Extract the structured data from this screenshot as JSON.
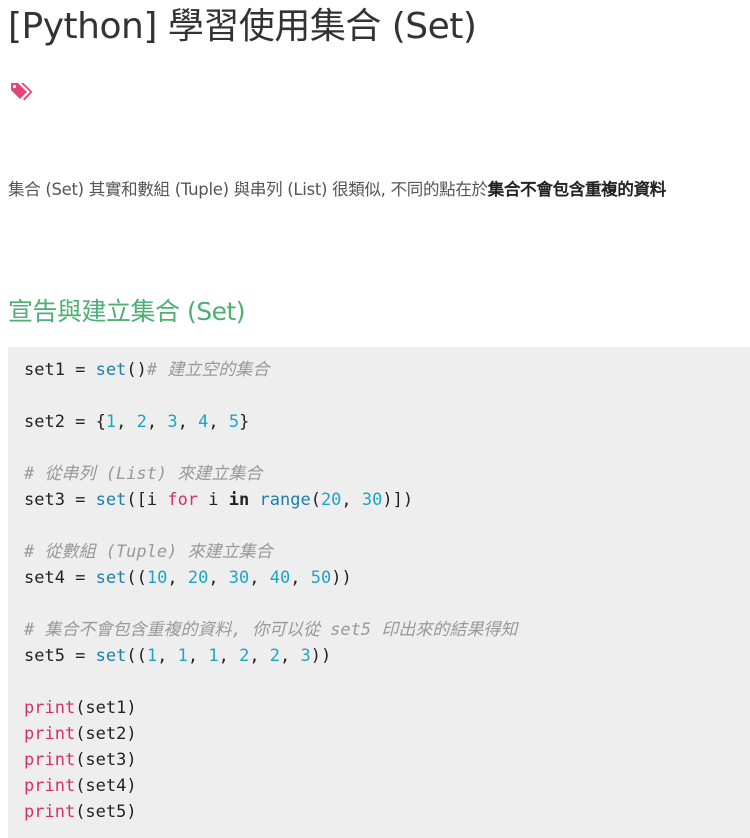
{
  "page": {
    "title": "[Python] 學習使用集合 (Set)",
    "tags_icon": "tags-icon"
  },
  "intro": {
    "text": "集合 (Set) 其實和數組 (Tuple) 與串列 (List) 很類似, 不同的點在於",
    "bold": "集合不會包含重複的資料"
  },
  "section": {
    "heading": "宣告與建立集合 (Set)"
  },
  "colors": {
    "heading_green": "#4caf74",
    "tag_pink": "#e0467a",
    "code_background": "#eeeeee",
    "number_blue": "#1aa5c9",
    "keyword_pink": "#d52f68",
    "comment_gray": "#999999"
  },
  "code_lines": [
    [
      {
        "t": "set1 = ",
        "c": "plain"
      },
      {
        "t": "set",
        "c": "builtin"
      },
      {
        "t": "()",
        "c": "plain"
      },
      {
        "t": "# 建立空的集合",
        "c": "comment"
      }
    ],
    [],
    [
      {
        "t": "set2 = {",
        "c": "plain"
      },
      {
        "t": "1",
        "c": "number"
      },
      {
        "t": ", ",
        "c": "plain"
      },
      {
        "t": "2",
        "c": "number"
      },
      {
        "t": ", ",
        "c": "plain"
      },
      {
        "t": "3",
        "c": "number"
      },
      {
        "t": ", ",
        "c": "plain"
      },
      {
        "t": "4",
        "c": "number"
      },
      {
        "t": ", ",
        "c": "plain"
      },
      {
        "t": "5",
        "c": "number"
      },
      {
        "t": "}",
        "c": "plain"
      }
    ],
    [],
    [
      {
        "t": "# 從串列 (List) 來建立集合",
        "c": "comment"
      }
    ],
    [
      {
        "t": "set3 = ",
        "c": "plain"
      },
      {
        "t": "set",
        "c": "builtin"
      },
      {
        "t": "([i ",
        "c": "plain"
      },
      {
        "t": "for",
        "c": "keyword"
      },
      {
        "t": " i ",
        "c": "plain"
      },
      {
        "t": "in",
        "c": "in"
      },
      {
        "t": " ",
        "c": "plain"
      },
      {
        "t": "range",
        "c": "builtin"
      },
      {
        "t": "(",
        "c": "plain"
      },
      {
        "t": "20",
        "c": "number"
      },
      {
        "t": ", ",
        "c": "plain"
      },
      {
        "t": "30",
        "c": "number"
      },
      {
        "t": ")])",
        "c": "plain"
      }
    ],
    [],
    [
      {
        "t": "# 從數組 (Tuple) 來建立集合",
        "c": "comment"
      }
    ],
    [
      {
        "t": "set4 = ",
        "c": "plain"
      },
      {
        "t": "set",
        "c": "builtin"
      },
      {
        "t": "((",
        "c": "plain"
      },
      {
        "t": "10",
        "c": "number"
      },
      {
        "t": ", ",
        "c": "plain"
      },
      {
        "t": "20",
        "c": "number"
      },
      {
        "t": ", ",
        "c": "plain"
      },
      {
        "t": "30",
        "c": "number"
      },
      {
        "t": ", ",
        "c": "plain"
      },
      {
        "t": "40",
        "c": "number"
      },
      {
        "t": ", ",
        "c": "plain"
      },
      {
        "t": "50",
        "c": "number"
      },
      {
        "t": "))",
        "c": "plain"
      }
    ],
    [],
    [
      {
        "t": "# 集合不會包含重複的資料, 你可以從 set5 印出來的結果得知",
        "c": "comment"
      }
    ],
    [
      {
        "t": "set5 = ",
        "c": "plain"
      },
      {
        "t": "set",
        "c": "builtin"
      },
      {
        "t": "((",
        "c": "plain"
      },
      {
        "t": "1",
        "c": "number"
      },
      {
        "t": ", ",
        "c": "plain"
      },
      {
        "t": "1",
        "c": "number"
      },
      {
        "t": ", ",
        "c": "plain"
      },
      {
        "t": "1",
        "c": "number"
      },
      {
        "t": ", ",
        "c": "plain"
      },
      {
        "t": "2",
        "c": "number"
      },
      {
        "t": ", ",
        "c": "plain"
      },
      {
        "t": "2",
        "c": "number"
      },
      {
        "t": ", ",
        "c": "plain"
      },
      {
        "t": "3",
        "c": "number"
      },
      {
        "t": "))",
        "c": "plain"
      }
    ],
    [],
    [
      {
        "t": "print",
        "c": "print"
      },
      {
        "t": "(set1)",
        "c": "plain"
      }
    ],
    [
      {
        "t": "print",
        "c": "print"
      },
      {
        "t": "(set2)",
        "c": "plain"
      }
    ],
    [
      {
        "t": "print",
        "c": "print"
      },
      {
        "t": "(set3)",
        "c": "plain"
      }
    ],
    [
      {
        "t": "print",
        "c": "print"
      },
      {
        "t": "(set4)",
        "c": "plain"
      }
    ],
    [
      {
        "t": "print",
        "c": "print"
      },
      {
        "t": "(set5)",
        "c": "plain"
      }
    ]
  ]
}
